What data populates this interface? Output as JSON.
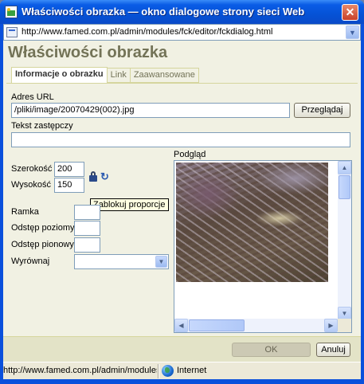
{
  "window": {
    "title": "Właściwości obrazka — okno dialogowe strony sieci Web",
    "close_glyph": "✕"
  },
  "address_bar": {
    "url": "http://www.famed.com.pl/admin/modules/fck/editor/fckdialog.html"
  },
  "dialog": {
    "title": "Właściwości obrazka",
    "tabs": [
      {
        "label": "Informacje o obrazku",
        "active": true
      },
      {
        "label": "Link",
        "active": false
      },
      {
        "label": "Zaawansowane",
        "active": false
      }
    ],
    "url_label": "Adres URL",
    "url_value": "/pliki/image/20070429(002).jpg",
    "browse_label": "Przeglądaj",
    "alt_label": "Tekst zastępczy",
    "alt_value": "",
    "width_label": "Szerokość",
    "width_value": "200",
    "height_label": "Wysokość",
    "height_value": "150",
    "lock_tooltip": "Zablokuj proporcje",
    "border_label": "Ramka",
    "border_value": "",
    "hspace_label": "Odstęp poziomy",
    "hspace_value": "",
    "vspace_label": "Odstęp pionowy",
    "vspace_value": "",
    "align_label": "Wyrównaj",
    "align_value": "",
    "preview_label": "Podgląd",
    "ok_label": "OK",
    "cancel_label": "Anuluj"
  },
  "status_bar": {
    "text": "http://www.famed.com.pl/admin/modules/fck/editor/fckdialog.html",
    "zone": "Internet"
  },
  "icons": {
    "window_icon": "window-icon",
    "address_icon": "page-icon",
    "lock": "lock-icon",
    "reset": "reset-size-icon",
    "globe": "globe-icon"
  }
}
